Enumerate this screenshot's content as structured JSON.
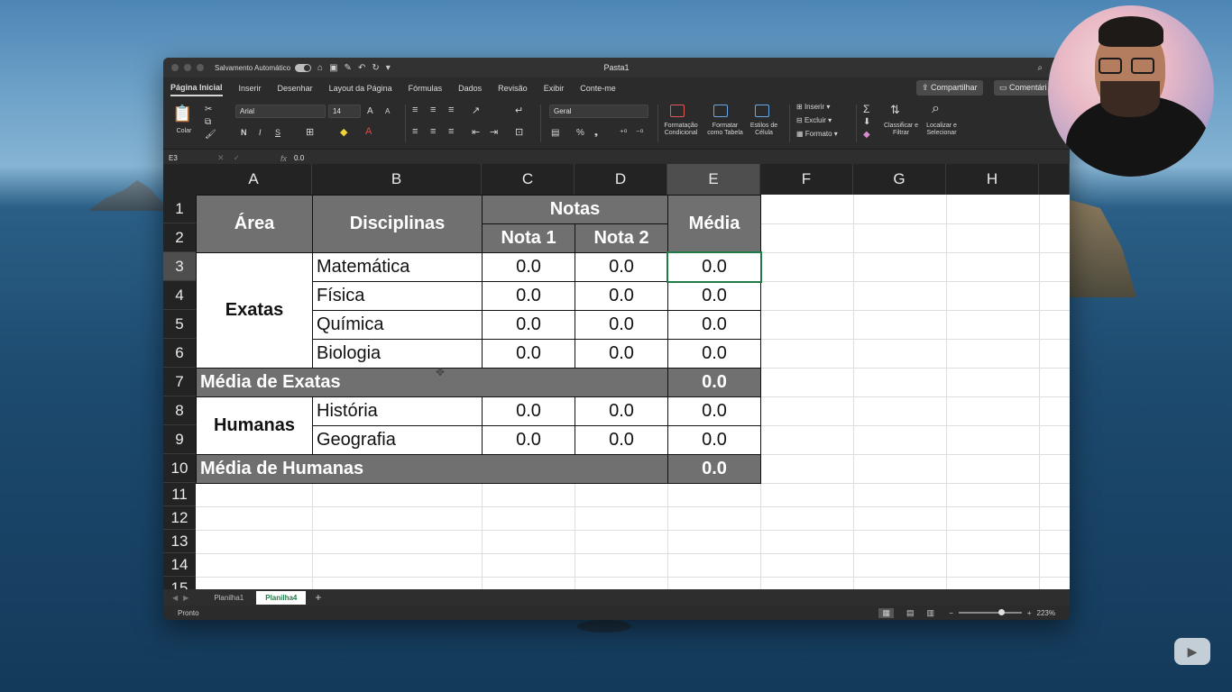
{
  "window": {
    "autosave_label": "Salvamento Automático",
    "doc_title": "Pasta1"
  },
  "menu": {
    "items": [
      "Página Inicial",
      "Inserir",
      "Desenhar",
      "Layout da Página",
      "Fórmulas",
      "Dados",
      "Revisão",
      "Exibir",
      "Conte-me"
    ],
    "share": "Compartilhar",
    "comments": "Comentári"
  },
  "ribbon": {
    "paste": "Colar",
    "font_name": "Arial",
    "font_size": "14",
    "bold": "N",
    "italic": "I",
    "underline": "S",
    "number_format": "Geral",
    "cond_format": "Formatação Condicional",
    "format_table": "Formatar como Tabela",
    "cell_styles": "Estilos de Célula",
    "insert": "Inserir",
    "delete": "Excluir",
    "format": "Formato",
    "sort_filter": "Classificar e Filtrar",
    "find_select": "Localizar e Selecionar"
  },
  "formula_bar": {
    "name_box": "E3",
    "fx": "fx",
    "value": "0.0"
  },
  "columns": [
    "A",
    "B",
    "C",
    "D",
    "E",
    "F",
    "G",
    "H"
  ],
  "rows": [
    "1",
    "2",
    "3",
    "4",
    "5",
    "6",
    "7",
    "8",
    "9",
    "10",
    "11",
    "12",
    "13",
    "14",
    "15"
  ],
  "table": {
    "area_header": "Área",
    "disciplinas_header": "Disciplinas",
    "notas_header": "Notas",
    "nota1_header": "Nota 1",
    "nota2_header": "Nota 2",
    "media_header": "Média",
    "exatas_label": "Exatas",
    "humanas_label": "Humanas",
    "exatas_rows": [
      {
        "disciplina": "Matemática",
        "nota1": "0.0",
        "nota2": "0.0",
        "media": "0.0"
      },
      {
        "disciplina": "Física",
        "nota1": "0.0",
        "nota2": "0.0",
        "media": "0.0"
      },
      {
        "disciplina": "Química",
        "nota1": "0.0",
        "nota2": "0.0",
        "media": "0.0"
      },
      {
        "disciplina": "Biologia",
        "nota1": "0.0",
        "nota2": "0.0",
        "media": "0.0"
      }
    ],
    "media_exatas_label": "Média de Exatas",
    "media_exatas_value": "0.0",
    "humanas_rows": [
      {
        "disciplina": "História",
        "nota1": "0.0",
        "nota2": "0.0",
        "media": "0.0"
      },
      {
        "disciplina": "Geografia",
        "nota1": "0.0",
        "nota2": "0.0",
        "media": "0.0"
      }
    ],
    "media_humanas_label": "Média de Humanas",
    "media_humanas_value": "0.0"
  },
  "sheets": {
    "tabs": [
      "Planilha1",
      "Planilha4"
    ],
    "active": "Planilha4",
    "add": "+"
  },
  "status": {
    "text": "Pronto",
    "zoom": "223%"
  },
  "colors": {
    "header_fill": "#707070",
    "active_border": "#1f7a45",
    "grid_header": "#232323"
  }
}
